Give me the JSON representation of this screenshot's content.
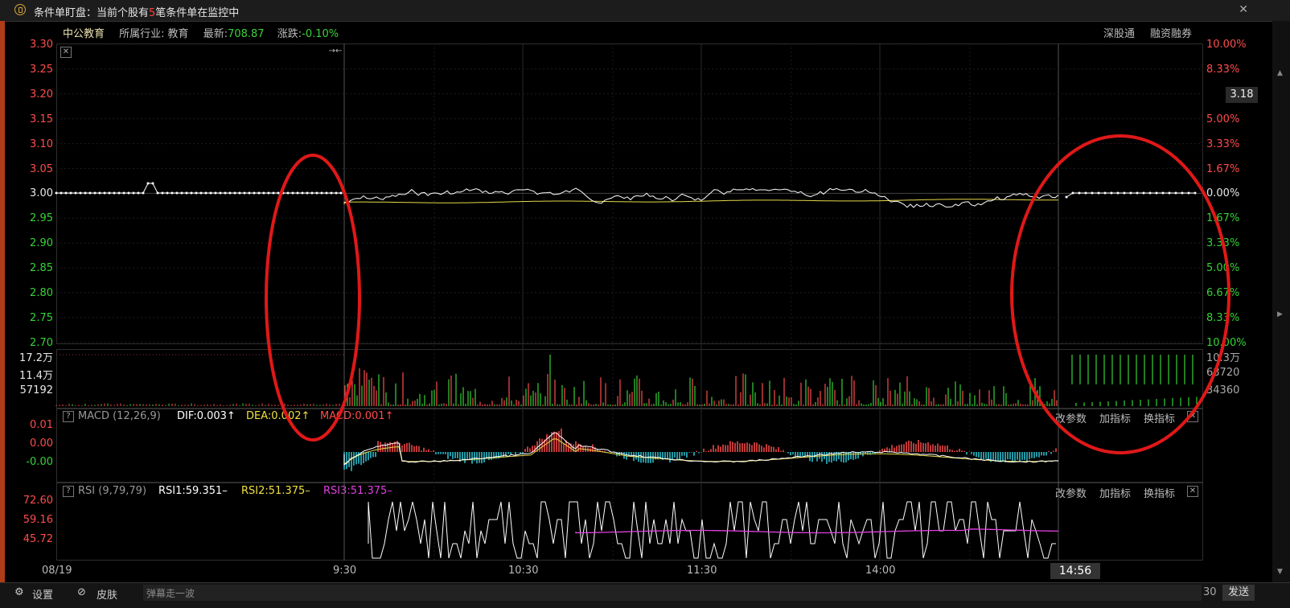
{
  "window": {
    "title_prefix": "条件单盯盘：当前个股有",
    "title_count": "5",
    "title_suffix": "笔条件单在监控中",
    "close": "✕"
  },
  "stock": {
    "name": "中公教育",
    "industry_label": "所属行业:",
    "industry": "教育",
    "latest_label": "最新:",
    "latest": "708.87",
    "change_label": "涨跌:",
    "change": "-0.10%",
    "tag1": "深股通",
    "tag2": "融资融券"
  },
  "price_axis": {
    "left": [
      "3.30",
      "3.25",
      "3.20",
      "3.15",
      "3.10",
      "3.05",
      "3.00",
      "2.95",
      "2.90",
      "2.85",
      "2.80",
      "2.75",
      "2.70"
    ],
    "right": [
      "10.00%",
      "8.33%",
      "",
      "5.00%",
      "3.33%",
      "1.67%",
      "0.00%",
      "1.67%",
      "3.33%",
      "5.00%",
      "6.67%",
      "8.33%",
      "10.00%"
    ],
    "current_price": "3.18",
    "pin_icon": "→←",
    "close_icon": "✕"
  },
  "volume_axis": {
    "left": [
      "17.2万",
      "11.4万",
      "57192"
    ],
    "right": [
      "10.3万",
      "68720",
      "34360"
    ]
  },
  "macd": {
    "help": "?",
    "name": "MACD (12,26,9)",
    "dif": "DIF:0.003↑",
    "dea": "DEA:0.002↑",
    "macd": "MACD:0.001↑",
    "axis": [
      "0.01",
      "0.00",
      "-0.00"
    ],
    "btn_params": "改参数",
    "btn_add": "加指标",
    "btn_switch": "换指标"
  },
  "rsi": {
    "help": "?",
    "name": "RSI (9,79,79)",
    "rsi1": "RSI1:59.351–",
    "rsi2": "RSI2:51.375–",
    "rsi3": "RSI3:51.375–",
    "axis": [
      "72.60",
      "59.16",
      "45.72"
    ],
    "btn_params": "改参数",
    "btn_add": "加指标",
    "btn_switch": "换指标"
  },
  "time_axis": {
    "date": "08/19",
    "labels": [
      "9:30",
      "10:30",
      "11:30",
      "14:00"
    ],
    "current": "14:56"
  },
  "status": {
    "settings": "设置",
    "skin": "皮肤",
    "input_value": "弹幕走一波",
    "count": "30",
    "send": "发送"
  },
  "colors": {
    "price_line": "#ffffff",
    "avg_line": "#e5d94a",
    "up": "#ff4c4c",
    "down": "#35d335",
    "annotation": "#e01818",
    "rsi3": "#e040e0"
  }
}
